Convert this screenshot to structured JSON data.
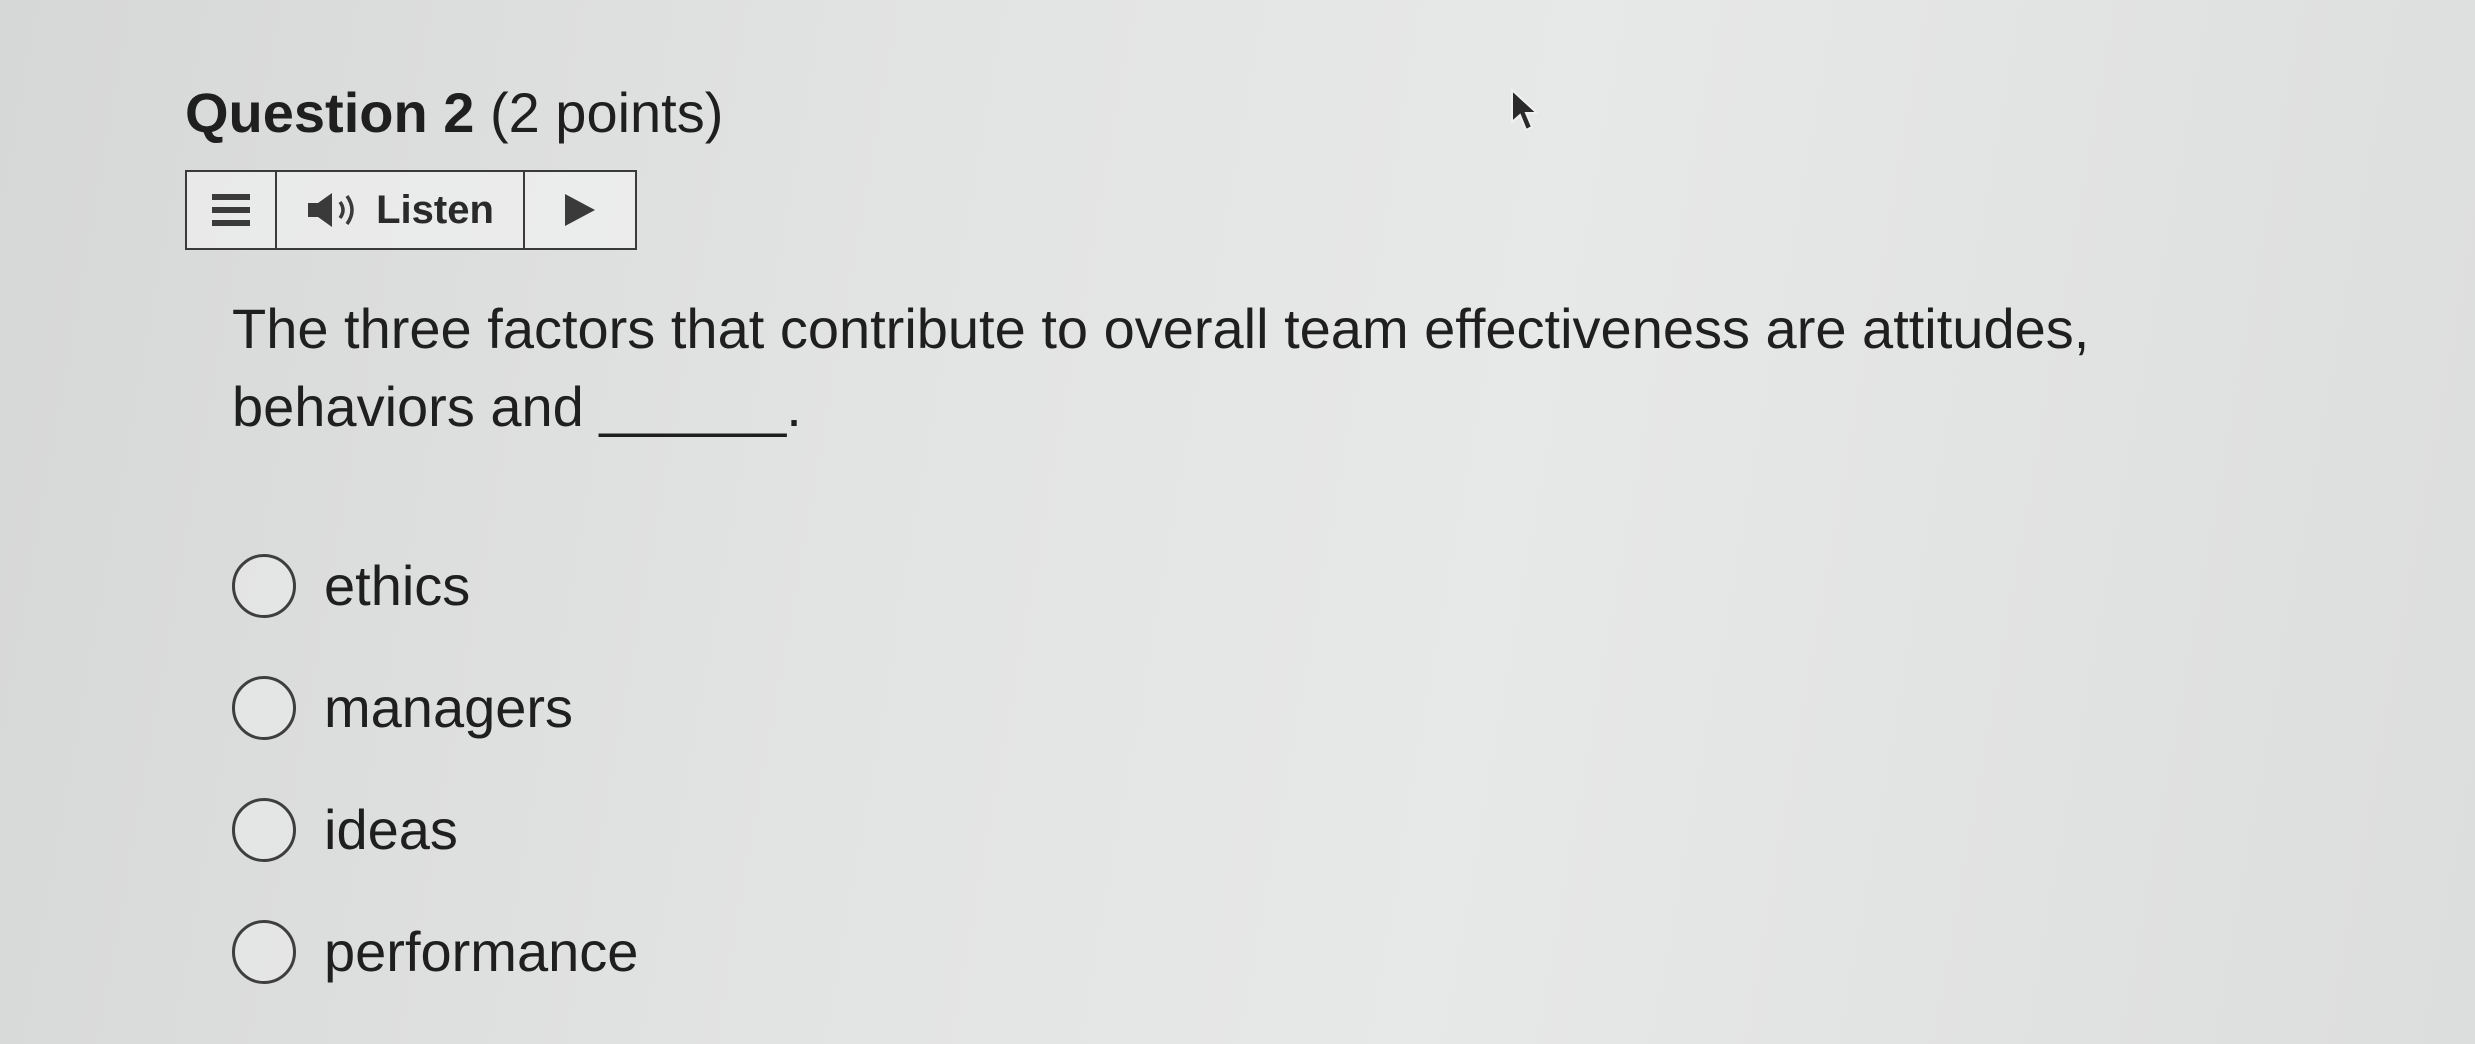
{
  "question": {
    "number_label": "Question 2",
    "points_label": "(2 points)"
  },
  "toolbar": {
    "menu_icon": "hamburger-icon",
    "speaker_icon": "speaker-icon",
    "listen_label": "Listen",
    "play_icon": "play-icon"
  },
  "prompt": {
    "text": "The three factors that contribute to overall team effectiveness are attitudes, behaviors and ______."
  },
  "options": [
    {
      "label": "ethics",
      "selected": false
    },
    {
      "label": "managers",
      "selected": false
    },
    {
      "label": "ideas",
      "selected": false
    },
    {
      "label": "performance",
      "selected": false
    }
  ]
}
